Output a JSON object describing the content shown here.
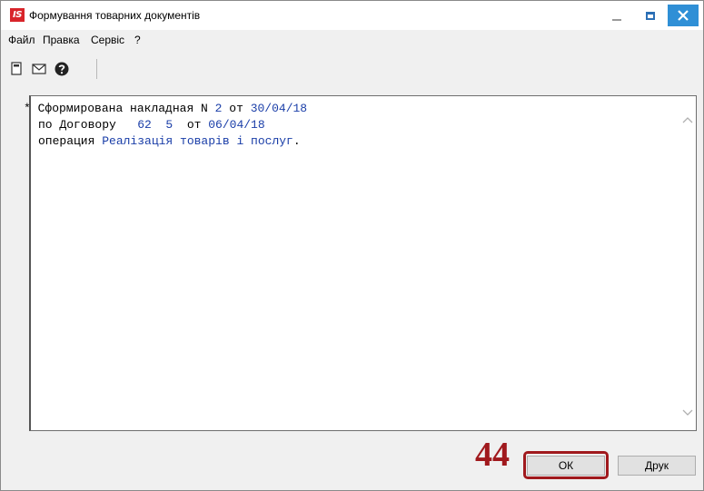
{
  "window": {
    "app_logo_text": "IS",
    "title": "Формування товарних документів",
    "minimize_icon": "minimize-icon",
    "maximize_icon": "maximize-icon",
    "close_icon": "close-icon",
    "close_color": "#2f8fd6"
  },
  "menu": {
    "items": [
      {
        "label": "Файл"
      },
      {
        "label": "Правка"
      },
      {
        "label": "Сервіс"
      },
      {
        "label": "?"
      }
    ]
  },
  "toolbar": {
    "buttons": [
      {
        "icon": "document-icon"
      },
      {
        "icon": "envelope-icon"
      },
      {
        "icon": "help-icon"
      }
    ]
  },
  "output": {
    "line1": {
      "bullet": "*",
      "text1": "Сформирована накладная N ",
      "number": "2",
      "text2": " от ",
      "date": "30/04/18"
    },
    "line2": {
      "text1": "по Договору   ",
      "contract": "62  5",
      "text2": "  от ",
      "date": "06/04/18"
    },
    "line3": {
      "text1": "операция ",
      "operation": "Реалізація товарів і послуг",
      "text2": "."
    },
    "value_color": "#1a3ea8"
  },
  "annotation": {
    "step_number": "44",
    "color": "#a0191d"
  },
  "buttons": {
    "ok_label": "ОК",
    "print_label": "Друк"
  }
}
